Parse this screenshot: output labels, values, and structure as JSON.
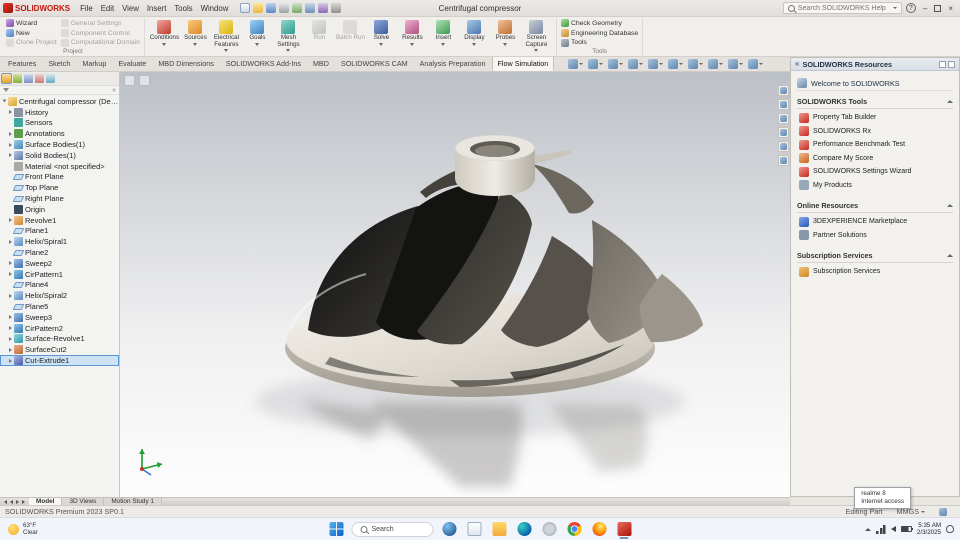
{
  "titlebar": {
    "app_name": "SOLIDWORKS",
    "menus": [
      "File",
      "Edit",
      "View",
      "Insert",
      "Tools",
      "Window"
    ],
    "quick_icons": [
      "new-doc",
      "open-doc",
      "save-doc",
      "print-doc",
      "undo",
      "redo",
      "rebuild",
      "options"
    ],
    "doc_title": "Centrifugal compressor",
    "search_placeholder": "Search SOLIDWORKS Help",
    "help_label": "?"
  },
  "ribbon": {
    "project_group": {
      "label": "Project",
      "col1": [
        {
          "label": "Wizard",
          "icon": "wizard"
        },
        {
          "label": "New",
          "icon": "new-project"
        },
        {
          "label": "Clone Project",
          "icon": "clone-project",
          "disabled": true
        }
      ],
      "col2": [
        {
          "label": "General Settings",
          "icon": "general-settings",
          "disabled": true
        },
        {
          "label": "Component Control",
          "icon": "component-control",
          "disabled": true
        },
        {
          "label": "Computational Domain",
          "icon": "computational-domain",
          "disabled": true
        }
      ]
    },
    "large_buttons": [
      {
        "label": "Conditions",
        "icon": "conditions",
        "dropdown": true
      },
      {
        "label": "Sources",
        "icon": "sources",
        "dropdown": true
      },
      {
        "label": "Electrical Features",
        "icon": "electrical-features",
        "dropdown": true
      },
      {
        "label": "Goals",
        "icon": "goals",
        "dropdown": true
      },
      {
        "label": "Mesh Settings",
        "icon": "mesh-settings",
        "dropdown": true
      },
      {
        "label": "Run",
        "icon": "run",
        "disabled": true
      },
      {
        "label": "Batch Run",
        "icon": "batch-run",
        "disabled": true
      },
      {
        "label": "Solve",
        "icon": "solve",
        "dropdown": true
      },
      {
        "label": "Results",
        "icon": "results",
        "dropdown": true
      },
      {
        "label": "Insert",
        "icon": "insert",
        "dropdown": true
      },
      {
        "label": "Display",
        "icon": "display",
        "dropdown": true
      },
      {
        "label": "Probes",
        "icon": "probes",
        "dropdown": true
      },
      {
        "label": "Screen Capture",
        "icon": "screen-capture",
        "dropdown": true
      }
    ],
    "tools_group": {
      "label": "Tools",
      "items": [
        {
          "label": "Check Geometry",
          "icon": "check-geometry"
        },
        {
          "label": "Engineering Database",
          "icon": "engineering-database"
        },
        {
          "label": "Tools",
          "icon": "tools",
          "dropdown": true
        }
      ]
    }
  },
  "command_tabs": [
    {
      "label": "Features"
    },
    {
      "label": "Sketch"
    },
    {
      "label": "Markup"
    },
    {
      "label": "Evaluate"
    },
    {
      "label": "MBD Dimensions"
    },
    {
      "label": "SOLIDWORKS Add-Ins"
    },
    {
      "label": "MBD"
    },
    {
      "label": "SOLIDWORKS CAM"
    },
    {
      "label": "Analysis Preparation"
    },
    {
      "label": "Flow Simulation",
      "active": true
    }
  ],
  "headsup_icons": [
    "zoom-fit",
    "zoom-area",
    "previous-view",
    "section-view",
    "view-orientation",
    "display-style",
    "hide-show-items",
    "edit-appearance",
    "view-settings",
    "camera"
  ],
  "feature_tree": {
    "tab_icons": [
      "feature-manager",
      "property-manager",
      "configuration-manager",
      "dimxpert-manager",
      "display-manager"
    ],
    "root": "Centrifugal compressor (Default) <<De",
    "items": [
      {
        "label": "History",
        "icon": "history",
        "arrow": true
      },
      {
        "label": "Sensors",
        "icon": "sensors"
      },
      {
        "label": "Annotations",
        "icon": "annotations",
        "arrow": true
      },
      {
        "label": "Surface Bodies(1)",
        "icon": "surface-bodies",
        "arrow": true
      },
      {
        "label": "Solid Bodies(1)",
        "icon": "solid-bodies",
        "arrow": true
      },
      {
        "label": "Material <not specified>",
        "icon": "material"
      },
      {
        "label": "Front Plane",
        "icon": "plane"
      },
      {
        "label": "Top Plane",
        "icon": "plane"
      },
      {
        "label": "Right Plane",
        "icon": "plane"
      },
      {
        "label": "Origin",
        "icon": "origin"
      },
      {
        "label": "Revolve1",
        "icon": "revolve",
        "arrow": true
      },
      {
        "label": "Plane1",
        "icon": "plane"
      },
      {
        "label": "Helix/Spiral1",
        "icon": "helix",
        "arrow": true
      },
      {
        "label": "Plane2",
        "icon": "plane"
      },
      {
        "label": "Sweep2",
        "icon": "sweep",
        "arrow": true
      },
      {
        "label": "CirPattern1",
        "icon": "pattern",
        "arrow": true
      },
      {
        "label": "Plane4",
        "icon": "plane"
      },
      {
        "label": "Helix/Spiral2",
        "icon": "helix",
        "arrow": true
      },
      {
        "label": "Plane5",
        "icon": "plane"
      },
      {
        "label": "Sweep3",
        "icon": "sweep",
        "arrow": true
      },
      {
        "label": "CirPattern2",
        "icon": "pattern",
        "arrow": true
      },
      {
        "label": "Surface-Revolve1",
        "icon": "surface-revolve",
        "arrow": true
      },
      {
        "label": "SurfaceCut2",
        "icon": "surface-cut",
        "arrow": true
      },
      {
        "label": "Cut-Extrude1",
        "icon": "cut-extrude",
        "arrow": true,
        "selected": true
      }
    ]
  },
  "taskpane": {
    "title": "SOLIDWORKS Resources",
    "tab_icons": [
      "solidworks-resources",
      "design-library",
      "file-explorer",
      "view-palette",
      "appearances",
      "custom-properties"
    ],
    "welcome": {
      "label": "Welcome to SOLIDWORKS",
      "icon": "home"
    },
    "sections": [
      {
        "title": "SOLIDWORKS Tools",
        "items": [
          {
            "label": "Property Tab Builder",
            "icon": "property-tab-builder"
          },
          {
            "label": "SOLIDWORKS Rx",
            "icon": "solidworks-rx"
          },
          {
            "label": "Performance Benchmark Test",
            "icon": "benchmark"
          },
          {
            "label": "Compare My Score",
            "icon": "compare-score"
          },
          {
            "label": "SOLIDWORKS Settings Wizard",
            "icon": "settings-wizard"
          },
          {
            "label": "My Products",
            "icon": "my-products"
          }
        ]
      },
      {
        "title": "Online Resources",
        "items": [
          {
            "label": "3DEXPERIENCE Marketplace",
            "icon": "marketplace"
          },
          {
            "label": "Partner Solutions",
            "icon": "partner-solutions"
          }
        ]
      },
      {
        "title": "Subscription Services",
        "items": [
          {
            "label": "Subscription Services",
            "icon": "subscription"
          }
        ]
      }
    ]
  },
  "model_tabs": {
    "tabs": [
      {
        "label": "Model",
        "active": true
      },
      {
        "label": "3D Views"
      },
      {
        "label": "Motion Study 1"
      }
    ]
  },
  "statusbar": {
    "product": "SOLIDWORKS Premium 2023 SP0.1",
    "mode": "Editing Part",
    "units": "MMGS"
  },
  "taskbar": {
    "weather": {
      "temp": "63°F",
      "condition": "Clear"
    },
    "search_label": "Search",
    "apps": [
      {
        "icon": "copilot"
      },
      {
        "icon": "task-view"
      },
      {
        "icon": "explorer"
      },
      {
        "icon": "edge"
      },
      {
        "icon": "settings-app"
      },
      {
        "icon": "chrome"
      },
      {
        "icon": "firefox"
      },
      {
        "icon": "solidworks-app",
        "active": true
      }
    ],
    "tray": {
      "time": "5:35 AM",
      "date": "2/3/2025"
    },
    "tooltip": {
      "line1": "realme 8",
      "line2": "Internet access"
    }
  }
}
